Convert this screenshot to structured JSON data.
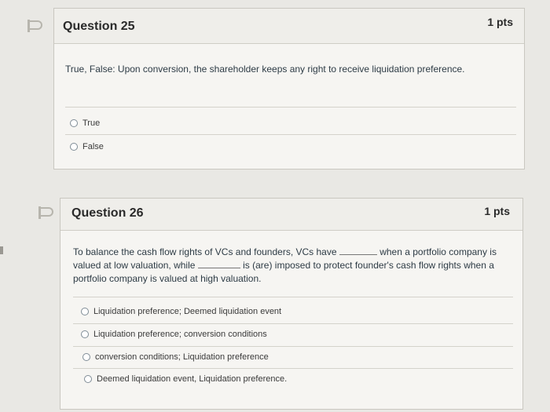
{
  "q25": {
    "title": "Question 25",
    "points": "1 pts",
    "text": "True, False: Upon conversion, the shareholder keeps any right to receive liquidation preference.",
    "options": [
      "True",
      "False"
    ]
  },
  "q26": {
    "title": "Question 26",
    "points": "1 pts",
    "text_parts": [
      "To balance the cash flow rights of VCs and founders, VCs have",
      "when a portfolio company is valued at low valuation, while",
      "is (are) imposed to protect founder's cash flow rights when a portfolio company is valued at high valuation."
    ],
    "options": [
      "Liquidation preference; Deemed liquidation event",
      "Liquidation preference; conversion conditions",
      "conversion conditions; Liquidation preference",
      "Deemed liquidation event, Liquidation preference."
    ]
  }
}
